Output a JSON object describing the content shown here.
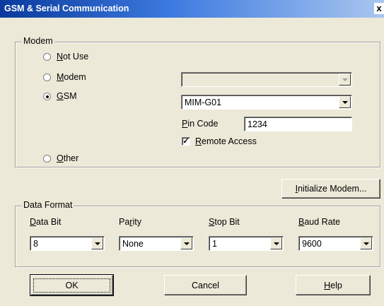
{
  "window": {
    "title": "GSM & Serial Communication",
    "close_glyph": "x"
  },
  "modem": {
    "group_label": "Modem",
    "options": [
      {
        "key": "N",
        "rest": "ot Use",
        "checked": false
      },
      {
        "key": "M",
        "rest": "odem",
        "checked": false
      },
      {
        "key": "G",
        "rest": "SM",
        "checked": true
      },
      {
        "key": "O",
        "rest": "ther",
        "checked": false
      }
    ],
    "modem_combo_value": "",
    "gsm_combo_value": "MIM-G01",
    "pin_code": {
      "key": "P",
      "rest": "in Code",
      "value": "1234"
    },
    "remote_access": {
      "key": "R",
      "rest": "emote Access",
      "checked": true,
      "mark": "✓"
    }
  },
  "initialize_button": {
    "key": "I",
    "rest": "nitialize Modem..."
  },
  "data_format": {
    "group_label": "Data Format",
    "fields": [
      {
        "key": "D",
        "rest": "ata Bit",
        "value": "8"
      },
      {
        "pre": "Pa",
        "key": "r",
        "rest": "ity",
        "value": "None"
      },
      {
        "key": "S",
        "rest": "top Bit",
        "value": "1"
      },
      {
        "key": "B",
        "rest": "aud Rate",
        "value": "9600"
      }
    ]
  },
  "buttons": {
    "ok": "OK",
    "cancel": "Cancel",
    "help": {
      "key": "H",
      "rest": "elp"
    }
  }
}
